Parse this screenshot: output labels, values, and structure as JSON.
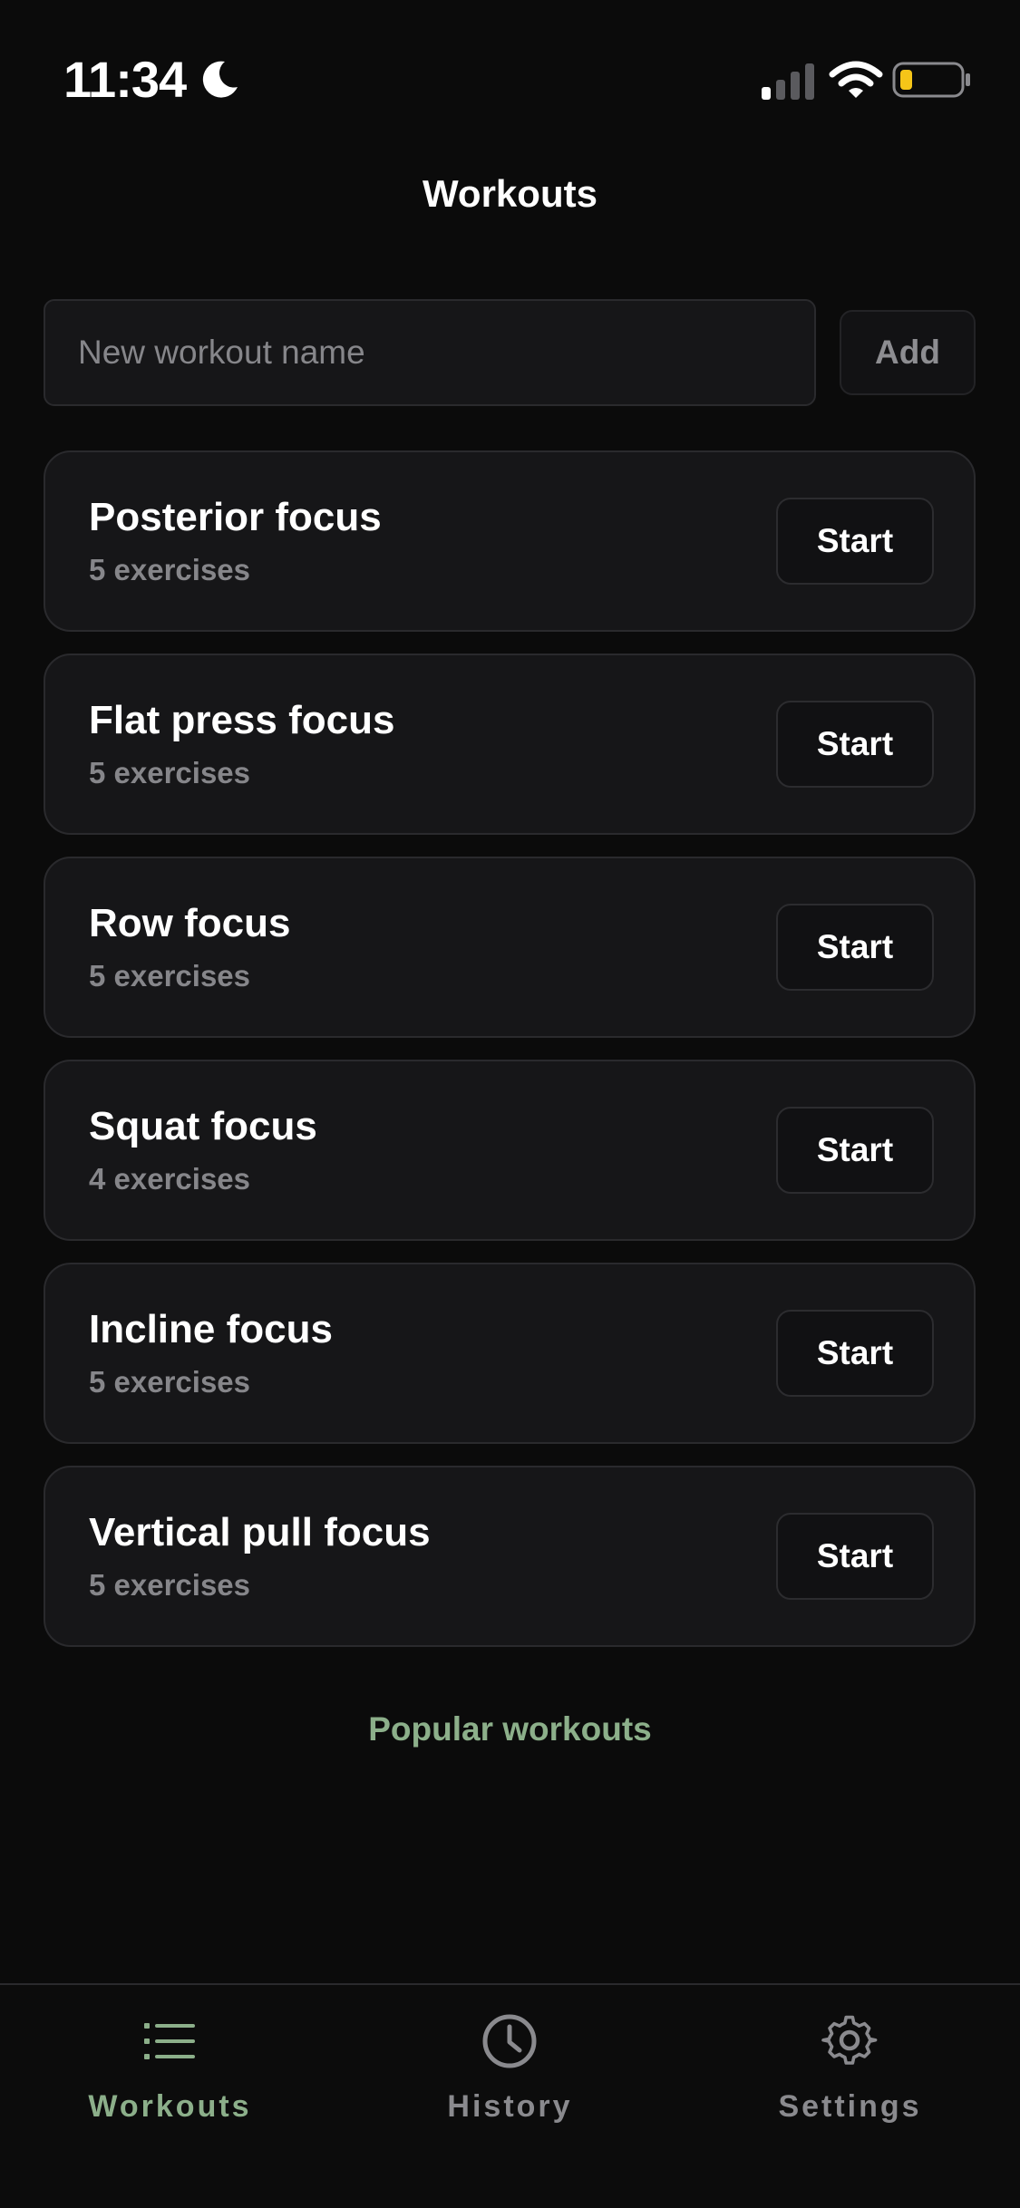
{
  "status_bar": {
    "time": "11:34",
    "icons": [
      "moon-icon",
      "signal-icon",
      "wifi-icon",
      "battery-icon"
    ],
    "battery_color": "#f5c518"
  },
  "header": {
    "title": "Workouts"
  },
  "new_workout": {
    "placeholder": "New workout name",
    "value": "",
    "add_label": "Add"
  },
  "workouts": [
    {
      "name": "Posterior focus",
      "count": "5 exercises",
      "action": "Start"
    },
    {
      "name": "Flat press focus",
      "count": "5 exercises",
      "action": "Start"
    },
    {
      "name": "Row focus",
      "count": "5 exercises",
      "action": "Start"
    },
    {
      "name": "Squat focus",
      "count": "4 exercises",
      "action": "Start"
    },
    {
      "name": "Incline focus",
      "count": "5 exercises",
      "action": "Start"
    },
    {
      "name": "Vertical pull focus",
      "count": "5 exercises",
      "action": "Start"
    }
  ],
  "popular_link": "Popular workouts",
  "tab_bar": {
    "active": "Workouts",
    "accent_color": "#8caf8a",
    "tabs": [
      {
        "label": "Workouts",
        "icon": "list-icon"
      },
      {
        "label": "History",
        "icon": "clock-icon"
      },
      {
        "label": "Settings",
        "icon": "gear-icon"
      }
    ]
  }
}
